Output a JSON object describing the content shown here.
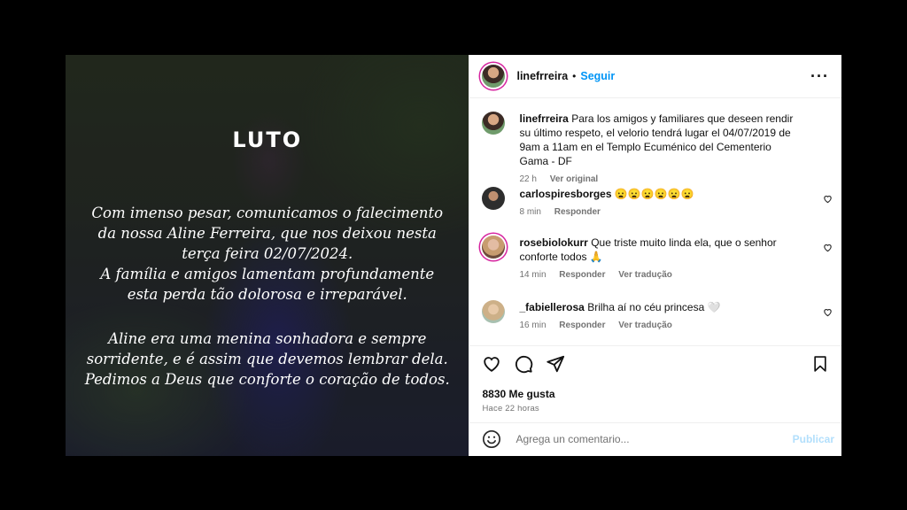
{
  "post": {
    "image": {
      "heading": "LUTO",
      "paragraph1": [
        "Com imenso pesar, comunicamos o falecimento",
        "da nossa Aline Ferreira, que nos deixou nesta",
        "terça feira 02/07/2024.",
        "A família e amigos lamentam profundamente",
        "esta perda tão dolorosa e irreparável."
      ],
      "paragraph2": [
        "Aline era uma menina sonhadora e sempre",
        "sorridente, e é assim que devemos lembrar dela.",
        "Pedimos a Deus que conforte o coração de todos."
      ]
    },
    "header": {
      "username": "linefrreira",
      "separator": "•",
      "follow_label": "Seguir",
      "more_label": "···"
    },
    "caption": {
      "username": "linefrreira",
      "text": "Para los amigos y familiares que deseen rendir su último respeto, el velorio tendrá lugar el 04/07/2019 de 9am a 11am en el Templo Ecuménico del Cementerio Gama - DF",
      "time": "22 h",
      "see_original": "Ver original"
    },
    "comments": [
      {
        "username": "carlospiresborges",
        "text": "😦😦😦😦😦😦",
        "time": "8 min",
        "reply": "Responder",
        "translate": ""
      },
      {
        "username": "rosebiolokurr",
        "text": "Que triste muito linda ela, que o senhor conforte todos 🙏",
        "time": "14 min",
        "reply": "Responder",
        "translate": "Ver tradução"
      },
      {
        "username": "_fabiellerosa",
        "text": "Brilha aí no céu princesa 🤍",
        "time": "16 min",
        "reply": "Responder",
        "translate": "Ver tradução"
      }
    ],
    "likes": "8830 Me gusta",
    "posted_ago": "Hace 22 horas",
    "add_comment": {
      "placeholder": "Agrega un comentario...",
      "publish_label": "Publicar"
    }
  },
  "colors": {
    "accent": "#0095f6",
    "publish_disabled": "#b2dffc",
    "muted_text": "#737373"
  },
  "icons": [
    "heart-icon",
    "comment-icon",
    "share-icon",
    "bookmark-icon",
    "emoji-icon",
    "more-icon"
  ]
}
